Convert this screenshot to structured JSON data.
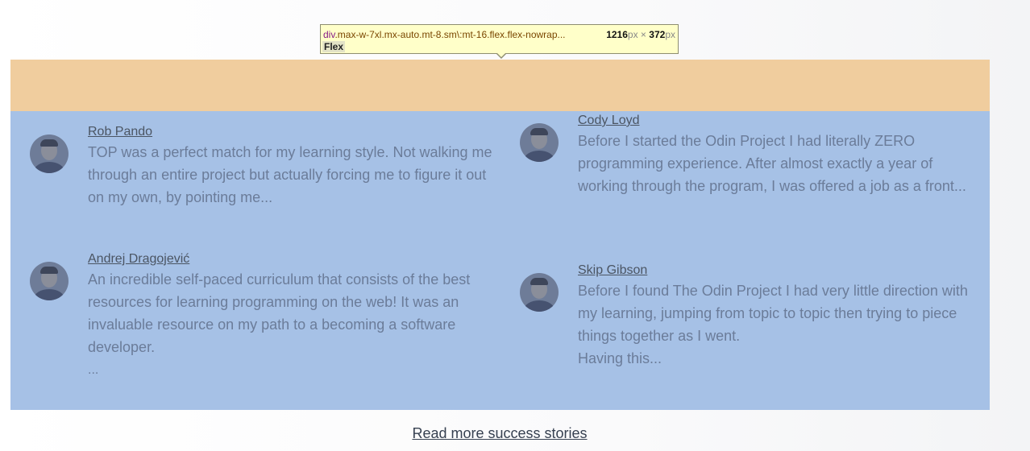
{
  "inspector_tooltip": {
    "tag": "div",
    "classes": ".max-w-7xl.mx-auto.mt-8.sm\\:mt-16.flex.flex-nowrap...",
    "width": "1216",
    "height": "372",
    "unit": "px",
    "times": "×",
    "badge": "Flex"
  },
  "stories": [
    {
      "name": "Rob Pando",
      "quote": "TOP was a perfect match for my learning style. Not walking me through an entire project but actually forcing me to figure it out on my own, by pointing me..."
    },
    {
      "name": "Cody Loyd",
      "quote": "Before I started the Odin Project I had literally ZERO programming experience. After almost exactly a year of working through the program, I was offered a job as a front..."
    },
    {
      "name": "Andrej Dragojević",
      "quote": "An incredible self-paced curriculum that consists of the best resources for learning programming on the web! It was an invaluable resource on my path to a becoming a software developer.",
      "ellipsis": "..."
    },
    {
      "name": "Skip Gibson",
      "quote": "Before I found The Odin Project I had very little direction with my learning, jumping from topic to topic then trying to piece things together as I went.",
      "quote_more": "Having this..."
    }
  ],
  "read_more_label": "Read more success stories",
  "colors": {
    "margin_overlay": "#f0cd9e",
    "content_overlay": "#a6c1e6",
    "tooltip_bg": "#ffffc9"
  }
}
